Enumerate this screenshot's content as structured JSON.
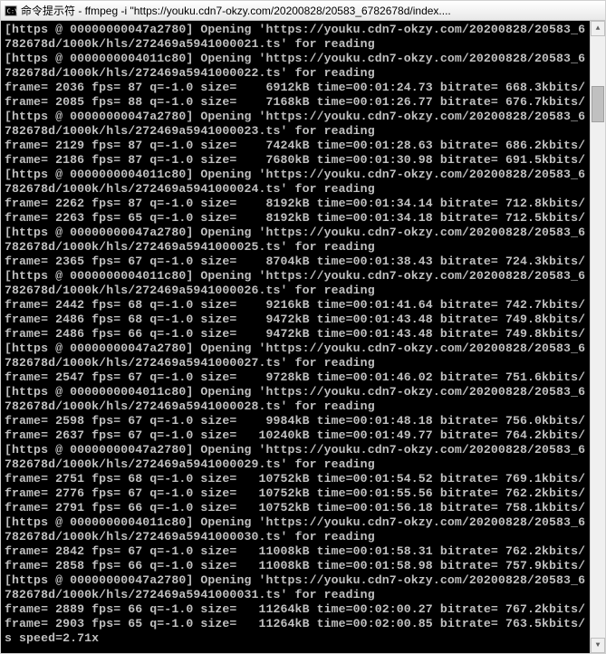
{
  "title": "命令提示符 - ffmpeg   -i  \"https://youku.cdn7-okzy.com/20200828/20583_6782678d/index....",
  "lines": [
    "[https @ 00000000047a2780] Opening 'https://youku.cdn7-okzy.com/20200828/20583_6",
    "782678d/1000k/hls/272469a5941000021.ts' for reading",
    "[https @ 0000000004011c80] Opening 'https://youku.cdn7-okzy.com/20200828/20583_6",
    "782678d/1000k/hls/272469a5941000022.ts' for reading",
    "frame= 2036 fps= 87 q=-1.0 size=    6912kB time=00:01:24.73 bitrate= 668.3kbits/",
    "frame= 2085 fps= 88 q=-1.0 size=    7168kB time=00:01:26.77 bitrate= 676.7kbits/",
    "[https @ 00000000047a2780] Opening 'https://youku.cdn7-okzy.com/20200828/20583_6",
    "782678d/1000k/hls/272469a5941000023.ts' for reading",
    "frame= 2129 fps= 87 q=-1.0 size=    7424kB time=00:01:28.63 bitrate= 686.2kbits/",
    "frame= 2186 fps= 87 q=-1.0 size=    7680kB time=00:01:30.98 bitrate= 691.5kbits/",
    "[https @ 0000000004011c80] Opening 'https://youku.cdn7-okzy.com/20200828/20583_6",
    "782678d/1000k/hls/272469a5941000024.ts' for reading",
    "frame= 2262 fps= 87 q=-1.0 size=    8192kB time=00:01:34.14 bitrate= 712.8kbits/",
    "frame= 2263 fps= 65 q=-1.0 size=    8192kB time=00:01:34.18 bitrate= 712.5kbits/",
    "[https @ 00000000047a2780] Opening 'https://youku.cdn7-okzy.com/20200828/20583_6",
    "782678d/1000k/hls/272469a5941000025.ts' for reading",
    "frame= 2365 fps= 67 q=-1.0 size=    8704kB time=00:01:38.43 bitrate= 724.3kbits/",
    "[https @ 0000000004011c80] Opening 'https://youku.cdn7-okzy.com/20200828/20583_6",
    "782678d/1000k/hls/272469a5941000026.ts' for reading",
    "frame= 2442 fps= 68 q=-1.0 size=    9216kB time=00:01:41.64 bitrate= 742.7kbits/",
    "frame= 2486 fps= 68 q=-1.0 size=    9472kB time=00:01:43.48 bitrate= 749.8kbits/",
    "frame= 2486 fps= 66 q=-1.0 size=    9472kB time=00:01:43.48 bitrate= 749.8kbits/",
    "[https @ 00000000047a2780] Opening 'https://youku.cdn7-okzy.com/20200828/20583_6",
    "782678d/1000k/hls/272469a5941000027.ts' for reading",
    "frame= 2547 fps= 67 q=-1.0 size=    9728kB time=00:01:46.02 bitrate= 751.6kbits/",
    "[https @ 0000000004011c80] Opening 'https://youku.cdn7-okzy.com/20200828/20583_6",
    "782678d/1000k/hls/272469a5941000028.ts' for reading",
    "frame= 2598 fps= 67 q=-1.0 size=    9984kB time=00:01:48.18 bitrate= 756.0kbits/",
    "frame= 2637 fps= 67 q=-1.0 size=   10240kB time=00:01:49.77 bitrate= 764.2kbits/",
    "[https @ 00000000047a2780] Opening 'https://youku.cdn7-okzy.com/20200828/20583_6",
    "782678d/1000k/hls/272469a5941000029.ts' for reading",
    "frame= 2751 fps= 68 q=-1.0 size=   10752kB time=00:01:54.52 bitrate= 769.1kbits/",
    "frame= 2776 fps= 67 q=-1.0 size=   10752kB time=00:01:55.56 bitrate= 762.2kbits/",
    "frame= 2791 fps= 66 q=-1.0 size=   10752kB time=00:01:56.18 bitrate= 758.1kbits/",
    "[https @ 0000000004011c80] Opening 'https://youku.cdn7-okzy.com/20200828/20583_6",
    "782678d/1000k/hls/272469a5941000030.ts' for reading",
    "frame= 2842 fps= 67 q=-1.0 size=   11008kB time=00:01:58.31 bitrate= 762.2kbits/",
    "frame= 2858 fps= 66 q=-1.0 size=   11008kB time=00:01:58.98 bitrate= 757.9kbits/",
    "[https @ 00000000047a2780] Opening 'https://youku.cdn7-okzy.com/20200828/20583_6",
    "782678d/1000k/hls/272469a5941000031.ts' for reading",
    "frame= 2889 fps= 66 q=-1.0 size=   11264kB time=00:02:00.27 bitrate= 767.2kbits/",
    "frame= 2903 fps= 65 q=-1.0 size=   11264kB time=00:02:00.85 bitrate= 763.5kbits/",
    "s speed=2.71x"
  ]
}
